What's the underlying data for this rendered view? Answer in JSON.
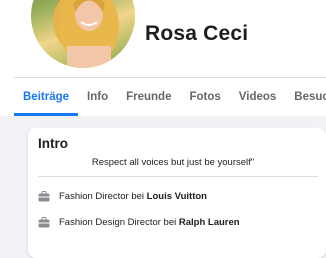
{
  "profile": {
    "name": "Rosa Ceci"
  },
  "tabs": [
    {
      "label": "Beiträge",
      "active": true
    },
    {
      "label": "Info",
      "active": false
    },
    {
      "label": "Freunde",
      "active": false
    },
    {
      "label": "Fotos",
      "active": false
    },
    {
      "label": "Videos",
      "active": false
    },
    {
      "label": "Besuche",
      "active": false
    }
  ],
  "intro": {
    "title": "Intro",
    "bio": "Respect all voices but just be yourself\"",
    "items": [
      {
        "icon": "briefcase-icon",
        "prefix": "Fashion Director bei ",
        "bold": "Louis Vuitton"
      },
      {
        "icon": "briefcase-icon",
        "prefix": "Fashion Design Director bei ",
        "bold": "Ralph Lauren"
      }
    ]
  },
  "colors": {
    "accent": "#1877f2",
    "tab_inactive": "#65676b",
    "background": "#f0f2f5"
  }
}
